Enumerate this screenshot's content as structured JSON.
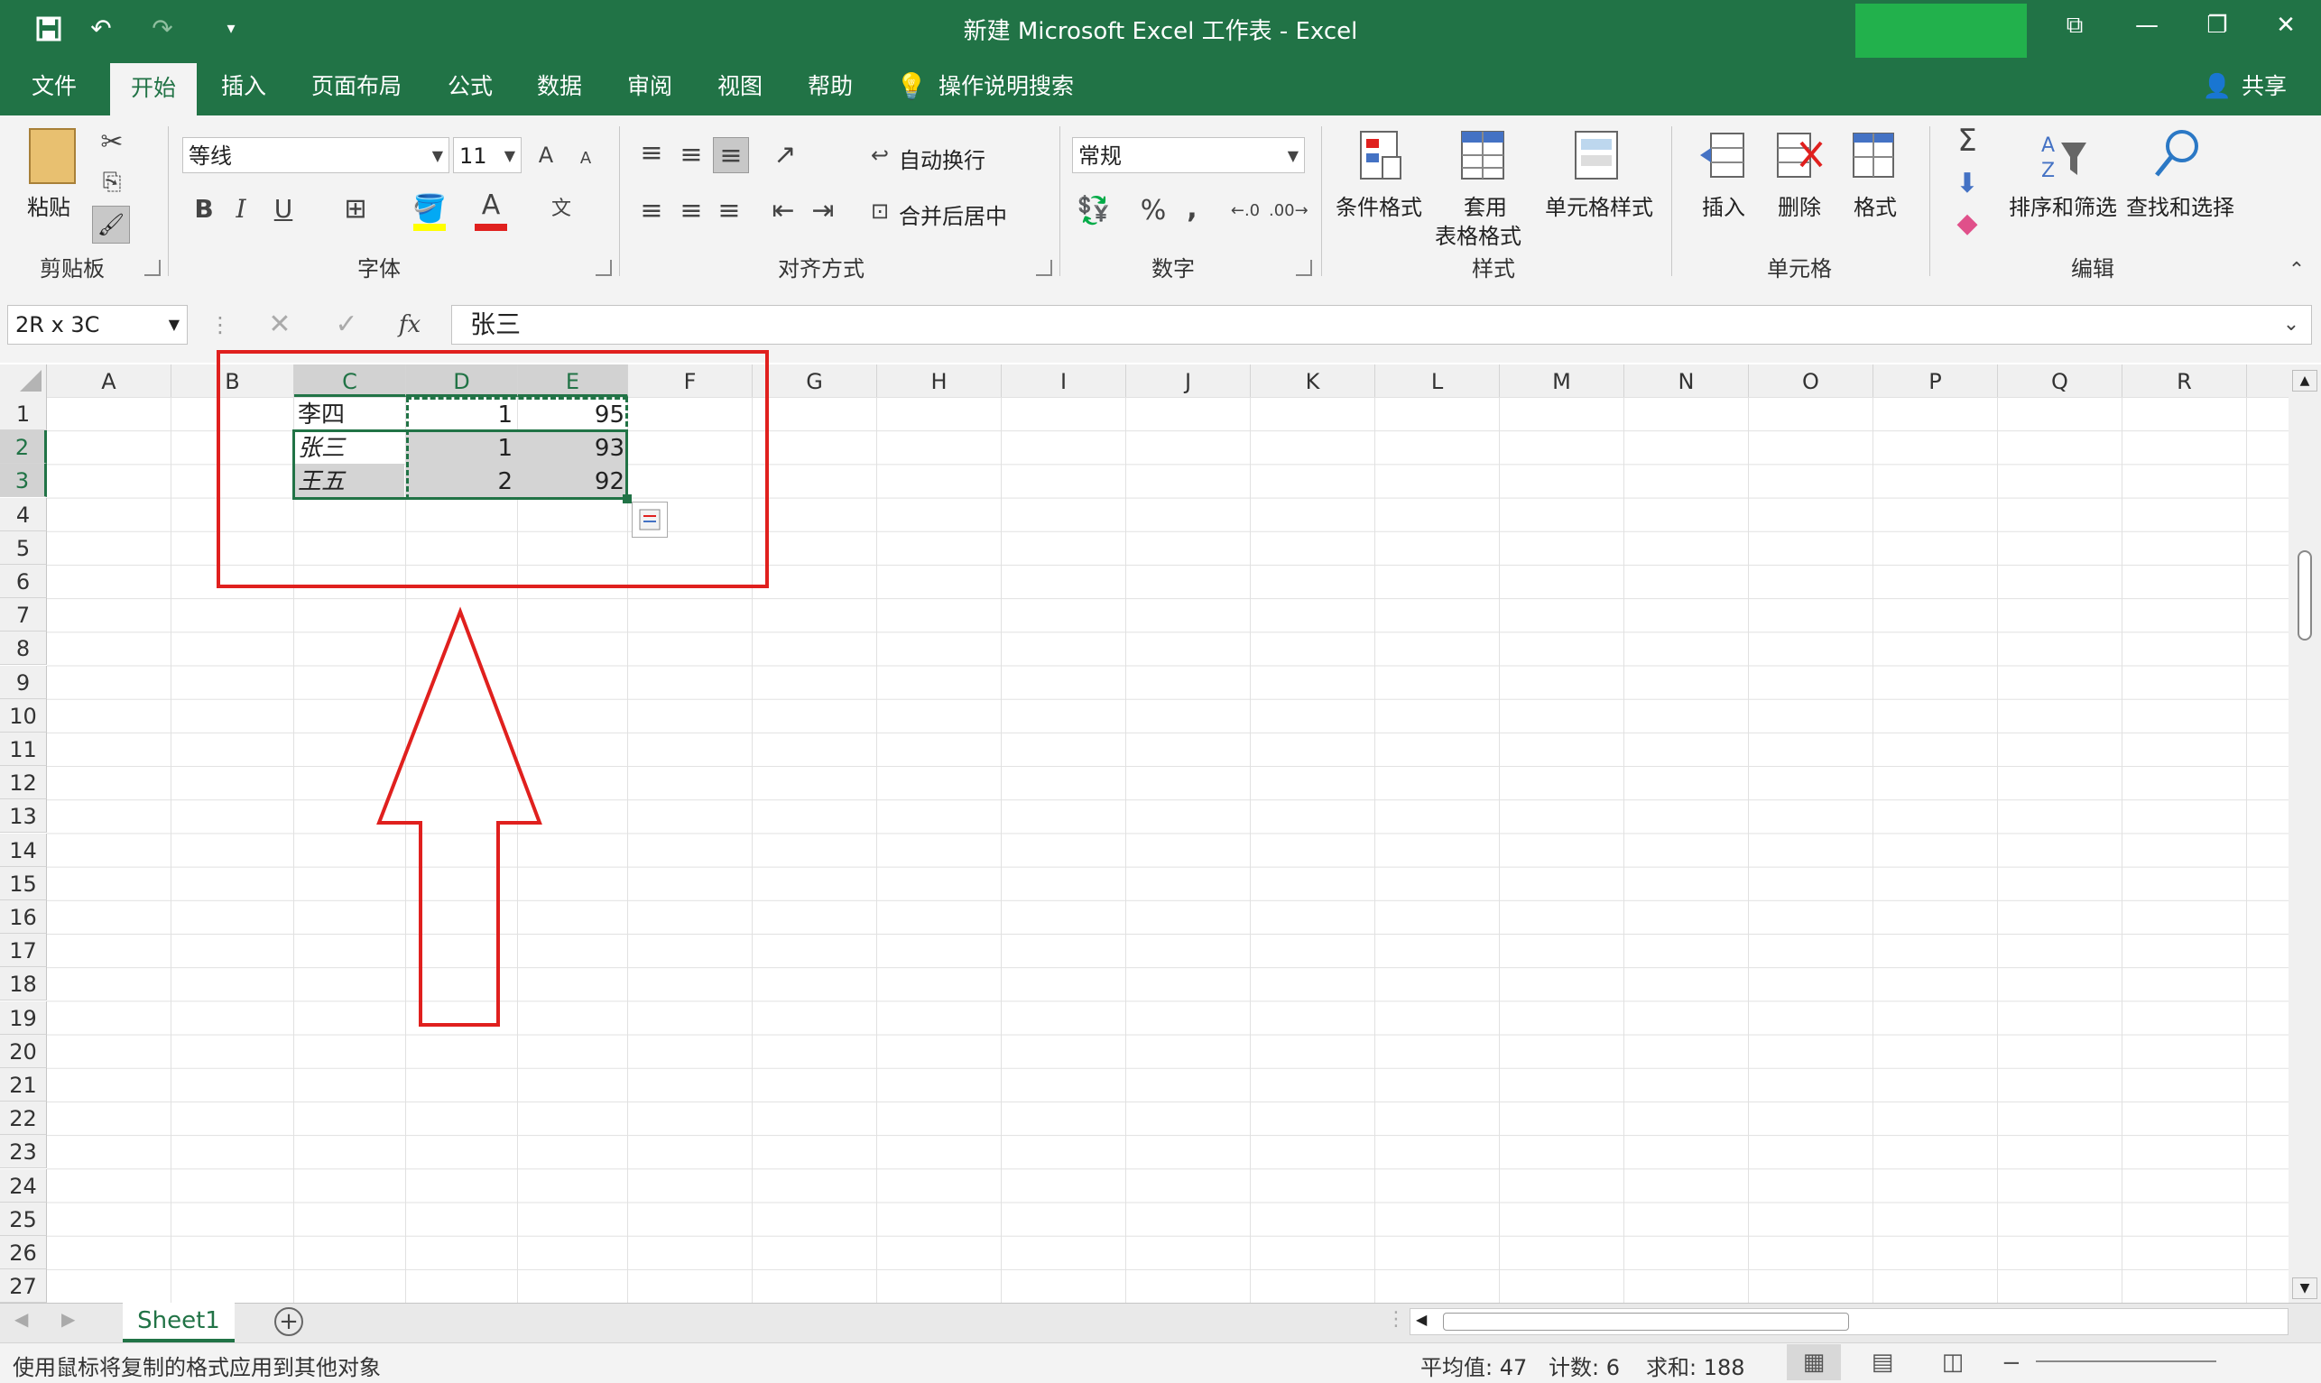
{
  "window": {
    "title": "新建 Microsoft Excel 工作表  -  Excel",
    "share": "共享"
  },
  "tabs": [
    "文件",
    "开始",
    "插入",
    "页面布局",
    "公式",
    "数据",
    "审阅",
    "视图",
    "帮助"
  ],
  "tell_me": "操作说明搜索",
  "ribbon": {
    "clipboard": {
      "label": "剪贴板",
      "paste": "粘贴"
    },
    "font": {
      "label": "字体",
      "name": "等线",
      "size": "11",
      "bold": "B",
      "italic": "I",
      "underline": "U",
      "grow": "A",
      "shrink": "A",
      "color_a": "A",
      "phonetic": "文"
    },
    "alignment": {
      "label": "对齐方式",
      "wrap": "自动换行",
      "merge": "合并后居中"
    },
    "number": {
      "label": "数字",
      "format": "常规",
      "percent": "%",
      "comma": ","
    },
    "styles": {
      "label": "样式",
      "conditional": "条件格式",
      "table_1": "套用",
      "table_2": "表格格式",
      "cell_styles": "单元格样式"
    },
    "cells": {
      "label": "单元格",
      "insert": "插入",
      "delete": "删除",
      "format": "格式"
    },
    "editing": {
      "label": "编辑",
      "sort": "排序和筛选",
      "find": "查找和选择",
      "sigma": "Σ"
    }
  },
  "formula_bar": {
    "name_box": "2R x 3C",
    "content": "张三",
    "fx": "fx"
  },
  "columns": [
    "A",
    "B",
    "C",
    "D",
    "E",
    "F",
    "G",
    "H",
    "I",
    "J",
    "K",
    "L",
    "M",
    "N",
    "O",
    "P",
    "Q",
    "R"
  ],
  "rows": [
    "1",
    "2",
    "3",
    "4",
    "5",
    "6",
    "7",
    "8",
    "9",
    "10",
    "11",
    "12",
    "13",
    "14",
    "15",
    "16",
    "17",
    "18",
    "19",
    "20",
    "21",
    "22",
    "23",
    "24",
    "25",
    "26",
    "27"
  ],
  "cells": [
    [
      "李四",
      "1",
      "95"
    ],
    [
      "张三",
      "1",
      "93"
    ],
    [
      "王五",
      "2",
      "92"
    ]
  ],
  "sheet": {
    "name": "Sheet1"
  },
  "status": {
    "message": "使用鼠标将复制的格式应用到其他对象",
    "average": "平均值: 47",
    "count": "计数: 6",
    "sum": "求和: 188"
  },
  "colors": {
    "brand": "#217346",
    "annotation": "#e0201e"
  }
}
